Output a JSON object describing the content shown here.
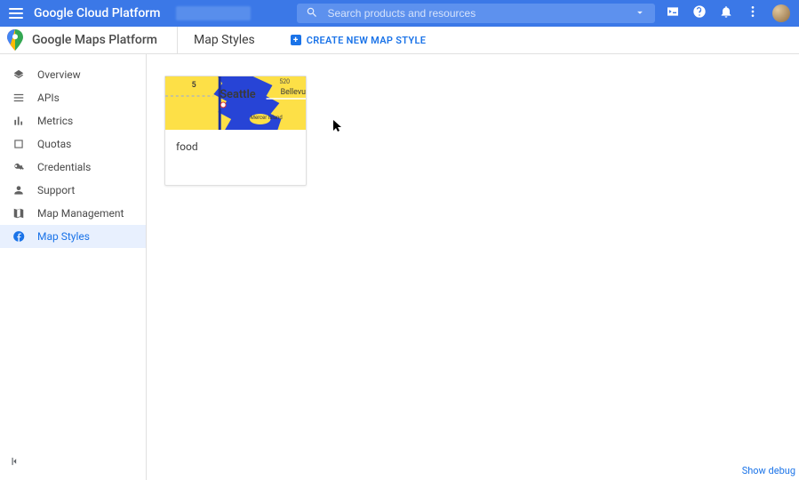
{
  "header": {
    "brand": "Google Cloud Platform",
    "search_placeholder": "Search products and resources"
  },
  "subheader": {
    "product_title": "Google Maps Platform",
    "page_title": "Map Styles",
    "create_label": "CREATE NEW MAP STYLE"
  },
  "sidebar": {
    "items": [
      {
        "label": "Overview"
      },
      {
        "label": "APIs"
      },
      {
        "label": "Metrics"
      },
      {
        "label": "Quotas"
      },
      {
        "label": "Credentials"
      },
      {
        "label": "Support"
      },
      {
        "label": "Map Management"
      },
      {
        "label": "Map Styles"
      }
    ]
  },
  "styles": {
    "cards": [
      {
        "name": "food"
      }
    ]
  },
  "map_preview": {
    "city_label": "Seattle",
    "east_label": "Bellevu",
    "island_label": "Mercer Island"
  },
  "footer": {
    "debug_label": "Show debug"
  },
  "colors": {
    "primary_blue": "#3b78e7",
    "accent_blue": "#1a73e8",
    "water_blue": "#2744d6",
    "land_yellow": "#fde047"
  }
}
